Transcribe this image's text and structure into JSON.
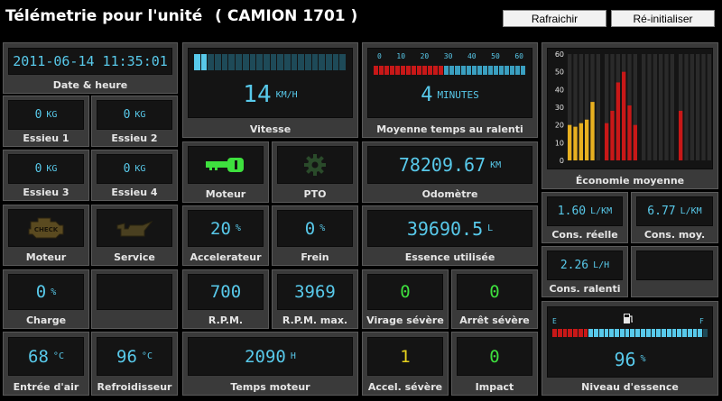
{
  "header": {
    "title": "Télémetrie pour l'unité",
    "unit": "( CAMION 1701 )"
  },
  "buttons": {
    "refresh": "Rafraichir",
    "reset": "Ré-initialiser"
  },
  "datetime": {
    "value": "2011-06-14 11:35:01",
    "label": "Date & heure"
  },
  "axles": [
    {
      "value": "0",
      "unit": "KG",
      "label": "Essieu 1"
    },
    {
      "value": "0",
      "unit": "KG",
      "label": "Essieu 2"
    },
    {
      "value": "0",
      "unit": "KG",
      "label": "Essieu 3"
    },
    {
      "value": "0",
      "unit": "KG",
      "label": "Essieu 4"
    }
  ],
  "engine_check": {
    "icon": "check-engine-icon",
    "label": "Moteur"
  },
  "service": {
    "icon": "oil-can-icon",
    "label": "Service"
  },
  "charge": {
    "value": "0",
    "unit": "%",
    "label": "Charge"
  },
  "intake_air": {
    "value": "68",
    "unit": "°C",
    "label": "Entrée d'air"
  },
  "coolant": {
    "value": "96",
    "unit": "°C",
    "label": "Refroidisseur"
  },
  "speed": {
    "value": "14",
    "unit": "KM/H",
    "label": "Vitesse",
    "level": 0.1
  },
  "engine_key": {
    "icon": "key-icon",
    "label": "Moteur"
  },
  "pto": {
    "icon": "gear-icon",
    "label": "PTO"
  },
  "accelerator": {
    "value": "20",
    "unit": "%",
    "label": "Accelerateur"
  },
  "brake": {
    "value": "0",
    "unit": "%",
    "label": "Frein"
  },
  "rpm": {
    "value": "700",
    "label": "R.P.M."
  },
  "rpm_max": {
    "value": "3969",
    "label": "R.P.M. max."
  },
  "engine_time": {
    "value": "2090",
    "unit": "H",
    "label": "Temps moteur"
  },
  "idle": {
    "value": "4",
    "unit": "MINUTES",
    "label": "Moyenne temps au ralenti",
    "ticks": [
      "0",
      "10",
      "20",
      "30",
      "40",
      "50",
      "60"
    ],
    "level": 0.07
  },
  "odometer": {
    "value": "78209.67",
    "unit": "KM",
    "label": "Odomètre"
  },
  "fuel_used": {
    "value": "39690.5",
    "unit": "L",
    "label": "Essence utilisée"
  },
  "hard_turn": {
    "value": "0",
    "label": "Virage sévère"
  },
  "hard_stop": {
    "value": "0",
    "label": "Arrêt sévère"
  },
  "hard_accel": {
    "value": "1",
    "label": "Accel. sévère"
  },
  "impact": {
    "value": "0",
    "label": "Impact"
  },
  "economy": {
    "label": "Économie moyenne"
  },
  "cons_real": {
    "value": "1.60",
    "unit": "L/KM",
    "label": "Cons. réelle"
  },
  "cons_avg": {
    "value": "6.77",
    "unit": "L/KM",
    "label": "Cons. moy."
  },
  "cons_idle": {
    "value": "2.26",
    "unit": "L/H",
    "label": "Cons. ralenti"
  },
  "fuel_level": {
    "value": "96",
    "unit": "%",
    "label": "Niveau d'essence",
    "left": "E",
    "right": "F",
    "level": 0.96,
    "icon": "fuel-pump-icon"
  },
  "colors": {
    "lcd": "#58c9ea",
    "green": "#3ee03e",
    "yellow": "#e6d21e",
    "red": "#c81818",
    "orange": "#e8b020",
    "panel": "#3a3a3a"
  },
  "chart_data": {
    "type": "bar",
    "title": "",
    "ylim": [
      0,
      60
    ],
    "yticks": [
      "0",
      "10",
      "20",
      "30",
      "40",
      "50",
      "60"
    ],
    "grid": true,
    "series": [
      {
        "values": [
          20,
          19,
          21,
          23,
          33
        ],
        "color": "#e8b020"
      },
      {
        "values": [
          21,
          28,
          44,
          50,
          31,
          20
        ],
        "color": "#c81818"
      },
      {
        "values": [],
        "color": "#c81818"
      },
      {
        "values": [
          28
        ],
        "color": "#c81818"
      }
    ]
  }
}
